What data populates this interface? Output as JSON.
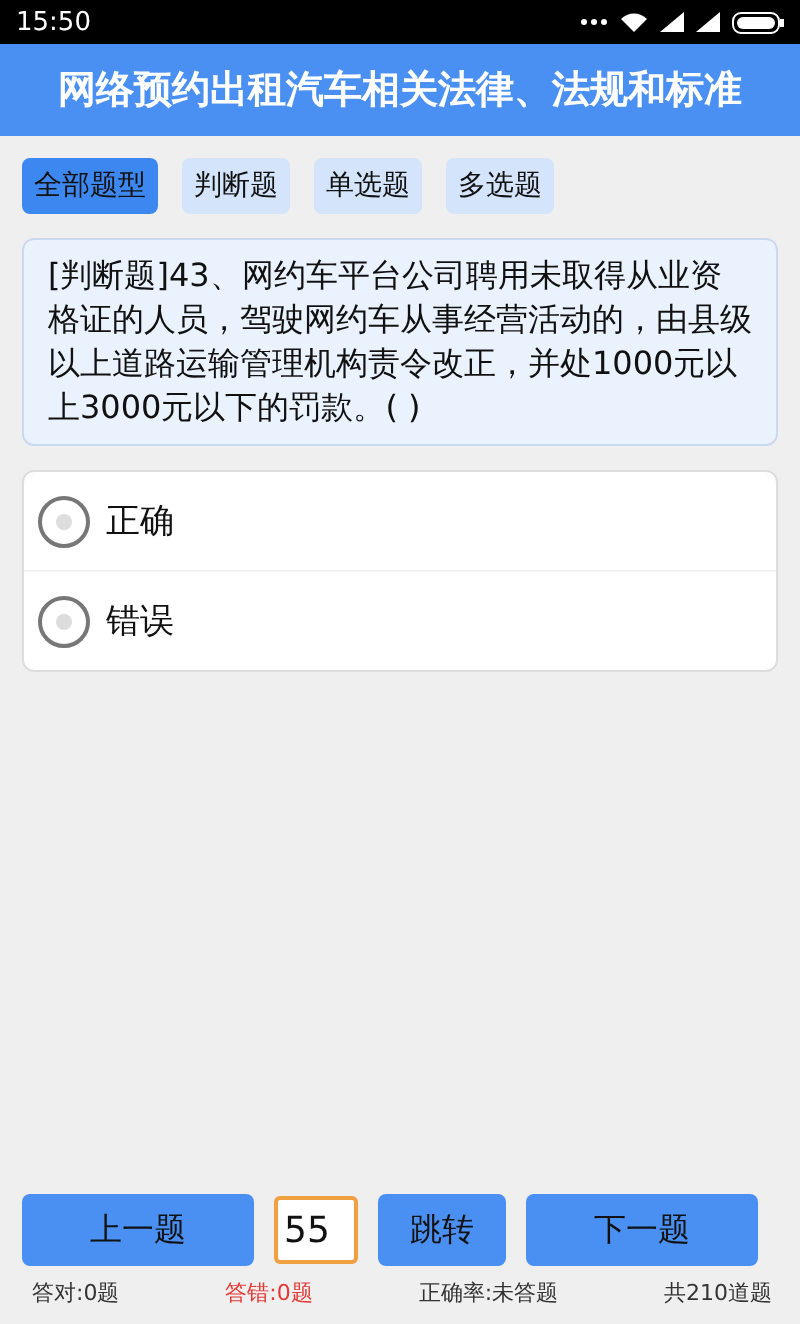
{
  "status_bar": {
    "time": "15:50"
  },
  "title": "网络预约出租汽车相关法律、法规和标准",
  "tabs": [
    {
      "label": "全部题型",
      "selected": true
    },
    {
      "label": "判断题",
      "selected": false
    },
    {
      "label": "单选题",
      "selected": false
    },
    {
      "label": "多选题",
      "selected": false
    }
  ],
  "question": "[判断题]43、网约车平台公司聘用未取得从业资格证的人员，驾驶网约车从事经营活动的，由县级以上道路运输管理机构责令改正，并处1000元以上3000元以下的罚款。( )",
  "options": [
    {
      "label": "正确",
      "selected": false
    },
    {
      "label": "错误",
      "selected": false
    }
  ],
  "nav": {
    "prev": "上一题",
    "page_input": "55",
    "jump": "跳转",
    "next": "下一题"
  },
  "stats": [
    {
      "text": "答对:0题",
      "kind": "normal"
    },
    {
      "text": "答错:0题",
      "kind": "wrong"
    },
    {
      "text": "正确率:未答题",
      "kind": "normal"
    },
    {
      "text": "共210道题",
      "kind": "normal"
    }
  ]
}
